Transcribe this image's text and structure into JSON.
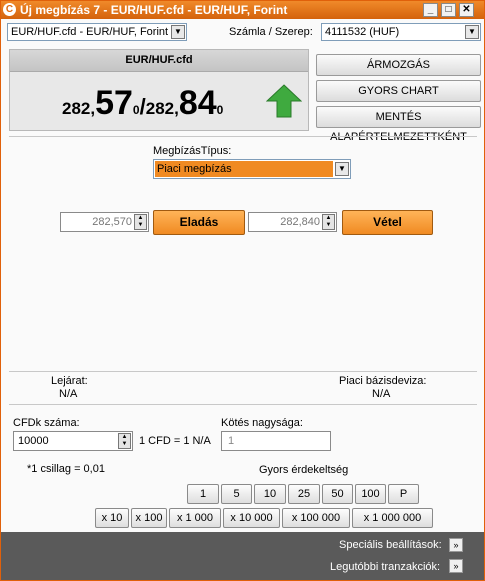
{
  "window": {
    "title": "Új megbízás 7 - EUR/HUF.cfd - EUR/HUF, Forint",
    "app_icon": "C",
    "controls": {
      "minimize": "_",
      "maximize": "□",
      "close": "✕"
    }
  },
  "instrument_combo": {
    "value": "EUR/HUF.cfd - EUR/HUF, Forint"
  },
  "account": {
    "label": "Számla / Szerep:",
    "value": "4111532 (HUF)"
  },
  "price_panel": {
    "symbol": "EUR/HUF.cfd",
    "bid_prefix": "282,",
    "bid_big": "57",
    "bid_suffix": "0",
    "divider": "/",
    "ask_prefix": "282,",
    "ask_big": "84",
    "ask_suffix": "0",
    "trend_icon": "arrow-up-icon",
    "trend_color": "#3faa3f"
  },
  "right_buttons": {
    "price_move": "ÁRMOZGÁS",
    "quick_chart": "GYORS CHART",
    "save_defaults": "MENTÉS ALAPÉRTELMEZETTKÉNT"
  },
  "order_type": {
    "label": "MegbízásTípus:",
    "value": "Piaci megbízás",
    "highlight": "#f08a22"
  },
  "sell": {
    "price": "282,570",
    "label": "Eladás"
  },
  "buy": {
    "price": "282,840",
    "label": "Vétel"
  },
  "expiry": {
    "label": "Lejárat:",
    "value": "N/A"
  },
  "base_currency": {
    "label": "Piaci bázisdeviza:",
    "value": "N/A"
  },
  "cfd_count": {
    "label": "CFDk száma:",
    "value": "10000",
    "ratio": "1 CFD = 1 N/A"
  },
  "deal_size": {
    "label": "Kötés nagysága:",
    "value": "1"
  },
  "star_note": "*1 csillag = 0,01",
  "quick_interest": {
    "label": "Gyors érdekeltség",
    "row1": [
      "1",
      "5",
      "10",
      "25",
      "50",
      "100",
      "P"
    ],
    "row2": [
      "x 10",
      "x 100",
      "x 1 000",
      "x 10 000",
      "x 100 000",
      "x 1 000 000"
    ]
  },
  "footer": {
    "special_settings": "Speciális beállítások:",
    "recent_transactions": "Legutóbbi tranzakciók:",
    "arrow": "»"
  },
  "colors": {
    "accent": "#f08a22",
    "title_bar": "#e06a10",
    "footer": "#5a5a5a"
  }
}
